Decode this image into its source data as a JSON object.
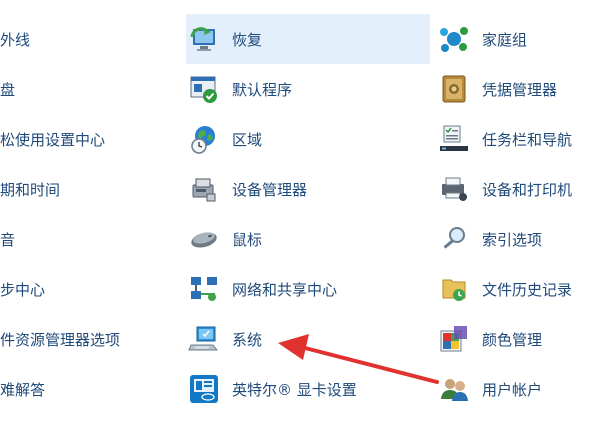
{
  "control_panel": {
    "left_column": [
      {
        "label": "外线"
      },
      {
        "label": "盘"
      },
      {
        "label": "松使用设置中心"
      },
      {
        "label": "期和时间"
      },
      {
        "label": "音"
      },
      {
        "label": "步中心"
      },
      {
        "label": "件资源管理器选项"
      },
      {
        "label": "难解答"
      }
    ],
    "middle_column": [
      {
        "label": "恢复",
        "icon": "recovery-icon",
        "highlighted": true
      },
      {
        "label": "默认程序",
        "icon": "default-programs-icon"
      },
      {
        "label": "区域",
        "icon": "region-icon"
      },
      {
        "label": "设备管理器",
        "icon": "device-manager-icon"
      },
      {
        "label": "鼠标",
        "icon": "mouse-icon"
      },
      {
        "label": "网络和共享中心",
        "icon": "network-sharing-icon"
      },
      {
        "label": "系统",
        "icon": "system-icon"
      },
      {
        "label": "英特尔® 显卡设置",
        "icon": "intel-graphics-icon"
      }
    ],
    "right_column": [
      {
        "label": "家庭组",
        "icon": "homegroup-icon"
      },
      {
        "label": "凭据管理器",
        "icon": "credential-manager-icon"
      },
      {
        "label": "任务栏和导航",
        "icon": "taskbar-icon"
      },
      {
        "label": "设备和打印机",
        "icon": "printer-icon"
      },
      {
        "label": "索引选项",
        "icon": "indexing-icon"
      },
      {
        "label": "文件历史记录",
        "icon": "file-history-icon"
      },
      {
        "label": "颜色管理",
        "icon": "color-management-icon"
      },
      {
        "label": "用户帐户",
        "icon": "user-accounts-icon"
      }
    ]
  },
  "annotation": {
    "icon": "red-arrow-icon",
    "color": "#e0322f"
  }
}
